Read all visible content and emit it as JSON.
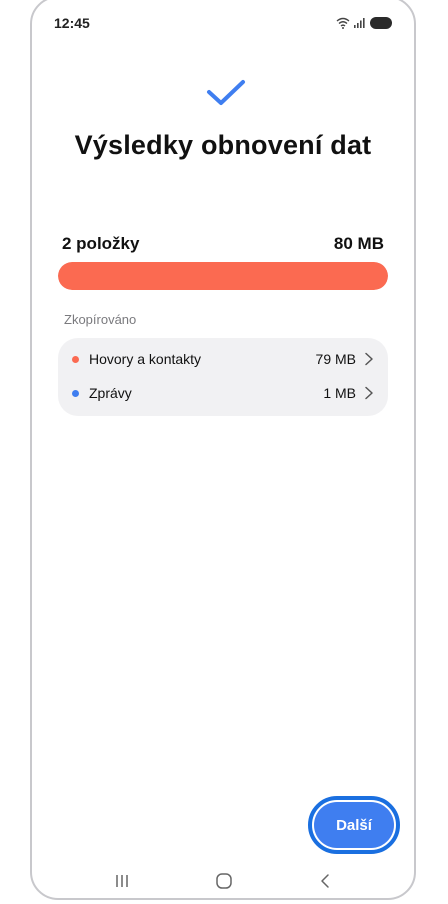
{
  "status_bar": {
    "time": "12:45"
  },
  "header": {
    "title": "Výsledky obnovení dat"
  },
  "summary": {
    "count_label": "2 položky",
    "total_size": "80 MB",
    "progress_fraction": 1.0,
    "progress_color": "#fb6a51"
  },
  "section": {
    "label": "Zkopírováno"
  },
  "items": [
    {
      "label": "Hovory a kontakty",
      "size": "79 MB",
      "dot_color": "#fb6a51"
    },
    {
      "label": "Zprávy",
      "size": "1 MB",
      "dot_color": "#3f7ef0"
    }
  ],
  "footer": {
    "next_label": "Další",
    "accent": "#3f7ef0"
  },
  "nav": {
    "recent_icon": "recent-apps-icon",
    "home_icon": "home-icon",
    "back_icon": "back-icon"
  }
}
